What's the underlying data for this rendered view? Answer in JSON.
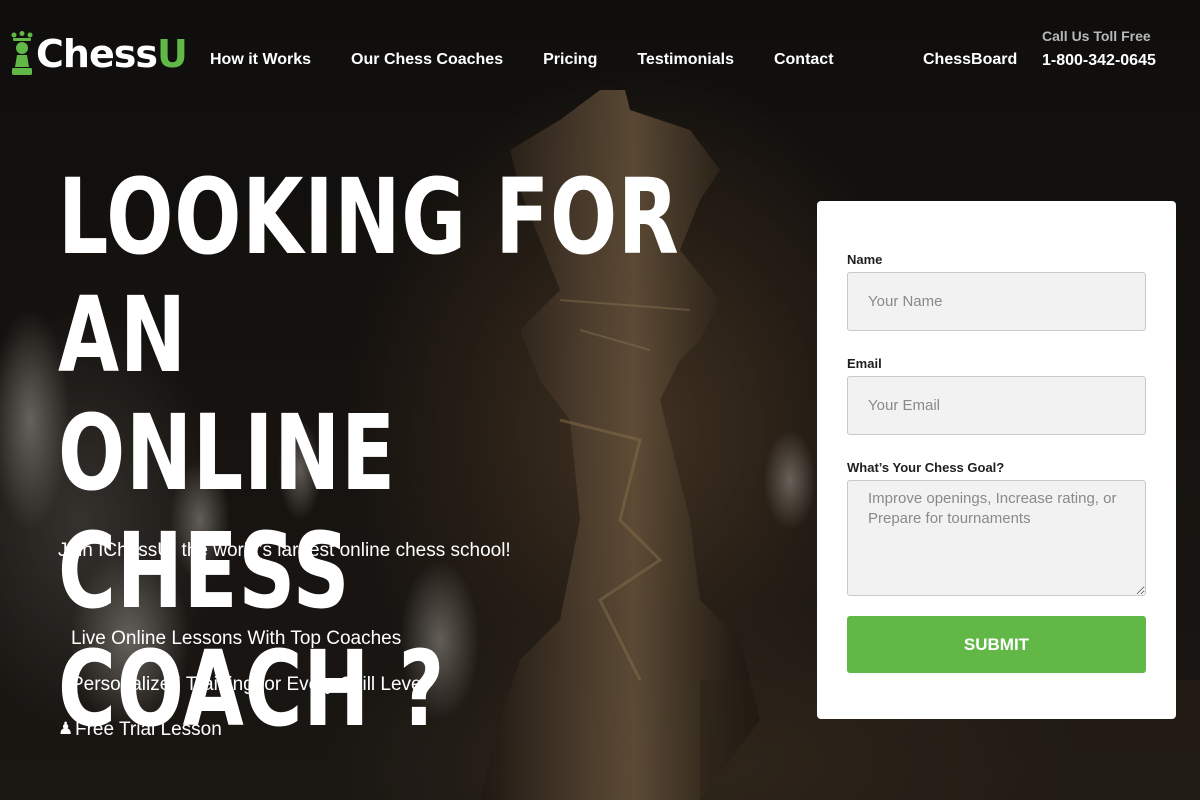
{
  "brand": {
    "logo_main": "Chess",
    "logo_accent": "U",
    "accent_color": "#61b847"
  },
  "nav": {
    "items": [
      "How it Works",
      "Our Chess Coaches",
      "Pricing",
      "Testimonials",
      "Contact"
    ],
    "chessboard": "ChessBoard"
  },
  "contact": {
    "caption": "Call Us Toll Free",
    "phone": "1-800-342-0645"
  },
  "hero": {
    "title_line1": "LOOKING FOR AN",
    "title_line2": "ONLINE CHESS",
    "title_line3": "COACH ?",
    "subtitle": "Join IChessU, the world’s largest online chess school!",
    "features": [
      {
        "icon": "missing-glyph-icon",
        "icon_char": "",
        "text": "Live Online Lessons With Top Coaches"
      },
      {
        "icon": "missing-glyph-icon",
        "icon_char": "",
        "text": "Personalized Training for Every Skill Level"
      },
      {
        "icon": "chess-pawn-icon",
        "icon_char": "♟",
        "text": "Free Trial Lesson"
      }
    ]
  },
  "form": {
    "name_label": "Name",
    "name_placeholder": "Your Name",
    "name_value": "",
    "email_label": "Email",
    "email_placeholder": "Your Email",
    "email_value": "",
    "goal_label": "What’s Your Chess Goal?",
    "goal_placeholder": "Improve openings, Increase rating, or Prepare for tournaments",
    "goal_value": "",
    "submit_label": "SUBMIT"
  }
}
